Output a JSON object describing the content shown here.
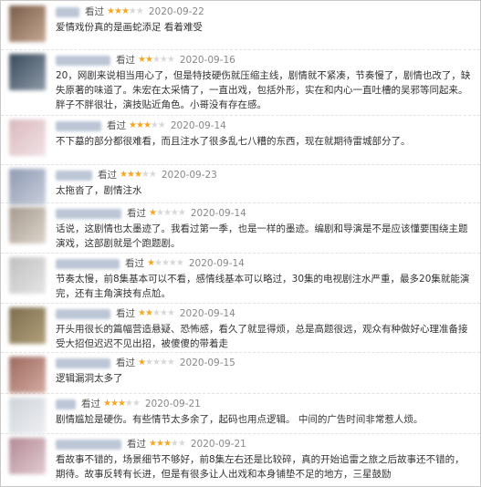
{
  "reviews": [
    {
      "seen": "看过",
      "rating": 3,
      "date": "2020-09-22",
      "text": "爱情戏份真的是画蛇添足 看着难受",
      "avatar_colors": [
        "#7a5d4a",
        "#c4a791"
      ]
    },
    {
      "seen": "看过",
      "rating": 2,
      "date": "2020-09-16",
      "text": "20，网剧来说相当用心了，但是特技硬伤就压缩主线，剧情就不紧凑，节奏慢了，剧情也改了，缺失原著的味道了。朱宏在太采情了，一直出戏，包括外形，实在和内心一直吐槽的吴邪等同起来。胖子不胖很壮，演技贴近角色。小哥没有存在感。",
      "avatar_colors": [
        "#394a5c",
        "#8d99a6"
      ]
    },
    {
      "seen": "看过",
      "rating": 3,
      "date": "2020-09-14",
      "text": "不下墓的部分都很难看，而且注水了很多乱七八糟的东西，现在就期待雷城部分了。",
      "avatar_colors": [
        "#d9b9bf",
        "#f2e2e5"
      ]
    },
    {
      "seen": "看过",
      "rating": 3,
      "date": "2020-09-23",
      "text": "太拖沓了，剧情注水",
      "avatar_colors": [
        "#8f9ab2",
        "#c9cfdc"
      ]
    },
    {
      "seen": "看过",
      "rating": 1,
      "date": "2020-09-14",
      "text": "话说，这剧情也太墨迹了。我看过第一季，也是一样的墨迹。编剧和导演是不是应该懂要围绕主题演戏，这部剧就是个跑题剧。",
      "avatar_colors": [
        "#a59a8e",
        "#ddd5cc"
      ]
    },
    {
      "seen": "看过",
      "rating": 1,
      "date": "2020-09-14",
      "text": "节奏太慢，前8集基本可以不看，感情线基本可以略过，30集的电视剧注水严重，最多20集就能演完，还有主角演技有点尬。",
      "avatar_colors": [
        "#bfbfbf",
        "#e6e6e6"
      ]
    },
    {
      "seen": "看过",
      "rating": 2,
      "date": "2020-09-14",
      "text": "开头用很长的篇幅营造悬疑、恐怖感，看久了就显得烦，总是高题很远，观众有种做好心理准备接受大招但迟迟不见出招，被傻傻的带着走",
      "avatar_colors": [
        "#7c6d4e",
        "#b2a17b"
      ]
    },
    {
      "seen": "看过",
      "rating": 1,
      "date": "2020-09-15",
      "text": "逻辑漏洞太多了",
      "avatar_colors": [
        "#9d6a5f",
        "#d4aba1"
      ]
    },
    {
      "seen": "看过",
      "rating": 3,
      "date": "2020-09-21",
      "text": "剧情尴尬是硬伤。有些情节太多余了，起码也用点逻辑。 中间的广告时间非常惹人烦。",
      "avatar_colors": [
        "#cfd2d8",
        "#eef0f3"
      ]
    },
    {
      "seen": "看过",
      "rating": 3,
      "date": "2020-09-21",
      "text": "看故事不错的，场景细节不够好，前8集左右还是比较碎，真的开始追雷之旅之后故事还不错的，期待。故事反转有长进，但是有很多让人出戏和本身铺垫不足的地方，三星鼓励",
      "avatar_colors": [
        "#b28a95",
        "#e3ccd2"
      ]
    }
  ]
}
